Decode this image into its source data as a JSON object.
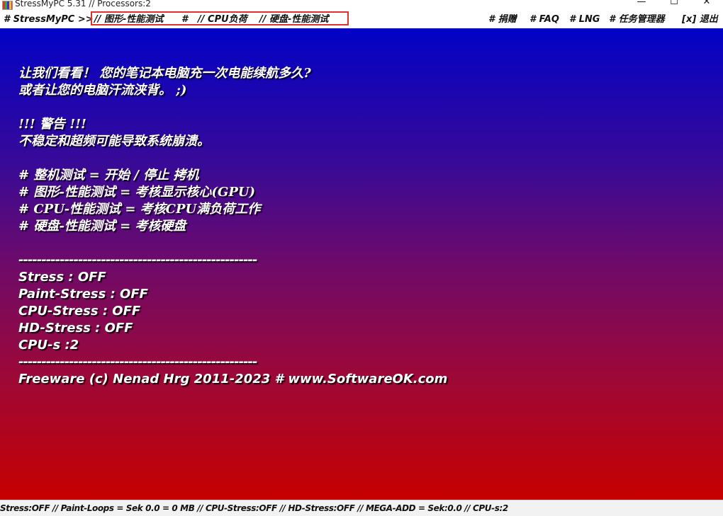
{
  "window": {
    "title": "StressMyPC 5.31 // Processors:2",
    "controls": {
      "minimize": "—",
      "maximize": "☐",
      "close": "✕"
    }
  },
  "menu": {
    "app": "# StressMyPC >>",
    "gpu_test": "// 图形-性能测试",
    "sep": "#",
    "cpu_load": "// CPU负荷",
    "disk_test": "// 硬盘-性能测试",
    "donate": "# 捐赠",
    "faq": "# FAQ",
    "lng": "# LNG",
    "task_manager": "# 任务管理器",
    "exit": "[x] 退出"
  },
  "content": {
    "intro_line1": "让我们看看！ 您的笔记本电脑充一次电能续航多久?",
    "intro_line2": "或者让您的电脑汗流浃背。 ;)",
    "warning_title": "!!! 警告 !!!",
    "warning_text": "不稳定和超频可能导致系统崩溃。",
    "help_stress": "# 整机测试 = 开始 / 停止 拷机",
    "help_paint": "# 图形-性能测试 = 考核显示核心(GPU)",
    "help_cpu": "# CPU-性能测试 = 考核CPU满负荷工作",
    "help_disk": "# 硬盘-性能测试 = 考核硬盘",
    "divider1": "----------------------------------------------------",
    "stress": "Stress : OFF",
    "paint_stress": "Paint-Stress : OFF",
    "cpu_stress": "CPU-Stress : OFF",
    "hd_stress": "HD-Stress : OFF",
    "cpus": "CPU-s :2",
    "divider2": "----------------------------------------------------",
    "footer": "Freeware (c) Nenad Hrg 2011-2023 # www.SoftwareOK.com"
  },
  "statusbar": {
    "text": "Stress:OFF // Paint-Loops = Sek 0.0 = 0 MB // CPU-Stress:OFF // HD-Stress:OFF // MEGA-ADD = Sek:0.0 // CPU-s:2"
  },
  "colors": {
    "gradient_top": "#0202c6",
    "gradient_bottom": "#c60000",
    "highlight_border": "#e03030"
  }
}
